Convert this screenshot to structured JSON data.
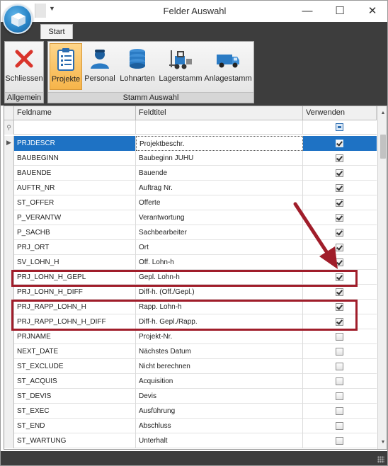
{
  "window": {
    "title": "Felder Auswahl",
    "controls": {
      "minimize": "—",
      "maximize": "☐",
      "close": "✕"
    }
  },
  "ribbon": {
    "tabs": [
      {
        "label": "Start",
        "active": true
      }
    ],
    "groups": [
      {
        "label": "Allgemein",
        "buttons": [
          {
            "label": "Schliessen",
            "icon": "close-x-icon"
          }
        ]
      },
      {
        "label": "Stamm Auswahl",
        "buttons": [
          {
            "label": "Projekte",
            "icon": "clipboard-checklist-icon",
            "active": true
          },
          {
            "label": "Personal",
            "icon": "person-icon"
          },
          {
            "label": "Lohnarten",
            "icon": "database-stack-icon"
          },
          {
            "label": "Lagerstamm",
            "icon": "forklift-icon"
          },
          {
            "label": "Anlagestamm",
            "icon": "van-icon"
          }
        ]
      }
    ]
  },
  "grid": {
    "columns": [
      "Feldname",
      "Feldtitel",
      "Verwenden"
    ],
    "rows": [
      {
        "feldname": "PRJDESCR",
        "feldtitel": "Projektbeschr.",
        "verwenden": true,
        "selected": true
      },
      {
        "feldname": "BAUBEGINN",
        "feldtitel": "Baubeginn JUHU",
        "verwenden": true
      },
      {
        "feldname": "BAUENDE",
        "feldtitel": "Bauende",
        "verwenden": true
      },
      {
        "feldname": "AUFTR_NR",
        "feldtitel": "Auftrag Nr.",
        "verwenden": true
      },
      {
        "feldname": "ST_OFFER",
        "feldtitel": "Offerte",
        "verwenden": true
      },
      {
        "feldname": "P_VERANTW",
        "feldtitel": "Verantwortung",
        "verwenden": true
      },
      {
        "feldname": "P_SACHB",
        "feldtitel": "Sachbearbeiter",
        "verwenden": true
      },
      {
        "feldname": "PRJ_ORT",
        "feldtitel": "Ort",
        "verwenden": true
      },
      {
        "feldname": "SV_LOHN_H",
        "feldtitel": "Off. Lohn-h",
        "verwenden": true
      },
      {
        "feldname": "PRJ_LOHN_H_GEPL",
        "feldtitel": "Gepl. Lohn-h",
        "verwenden": true,
        "highlighted": true
      },
      {
        "feldname": "PRJ_LOHN_H_DIFF",
        "feldtitel": "Diff-h. (Off./Gepl.)",
        "verwenden": true
      },
      {
        "feldname": "PRJ_RAPP_LOHN_H",
        "feldtitel": "Rapp. Lohn-h",
        "verwenden": true,
        "highlighted": true
      },
      {
        "feldname": "PRJ_RAPP_LOHN_H_DIFF",
        "feldtitel": "Diff-h. Gepl./Rapp.",
        "verwenden": true,
        "highlighted": true
      },
      {
        "feldname": "PRJNAME",
        "feldtitel": "Projekt-Nr.",
        "verwenden": false
      },
      {
        "feldname": "NEXT_DATE",
        "feldtitel": "Nächstes Datum",
        "verwenden": false
      },
      {
        "feldname": "ST_EXCLUDE",
        "feldtitel": "Nicht berechnen",
        "verwenden": false
      },
      {
        "feldname": "ST_ACQUIS",
        "feldtitel": "Acquisition",
        "verwenden": false
      },
      {
        "feldname": "ST_DEVIS",
        "feldtitel": "Devis",
        "verwenden": false
      },
      {
        "feldname": "ST_EXEC",
        "feldtitel": "Ausführung",
        "verwenden": false
      },
      {
        "feldname": "ST_END",
        "feldtitel": "Abschluss",
        "verwenden": false
      },
      {
        "feldname": "ST_WARTUNG",
        "feldtitel": "Unterhalt",
        "verwenden": false
      }
    ]
  },
  "annotation": {
    "color": "#a01d2a"
  },
  "colors": {
    "accent": "#1e72c4",
    "ribbon_dark": "#3d3d3d",
    "active_button": "#f6b44a"
  }
}
